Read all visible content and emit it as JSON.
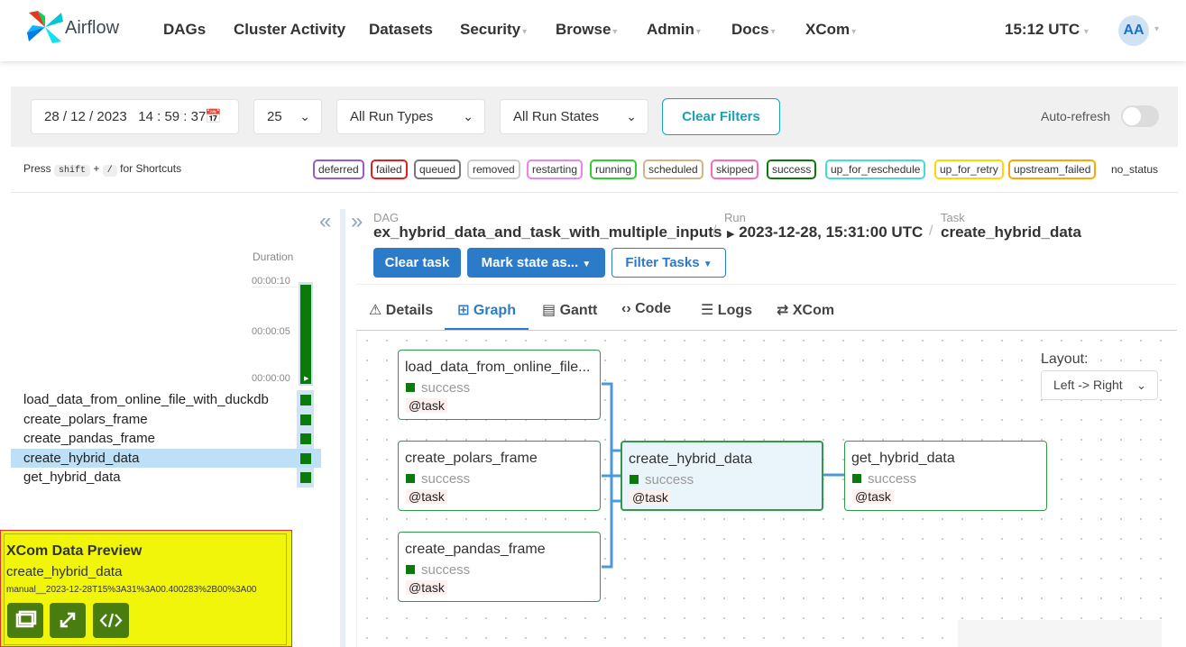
{
  "nav": {
    "brand": "Airflow",
    "items": [
      "DAGs",
      "Cluster Activity",
      "Datasets",
      "Security",
      "Browse",
      "Admin",
      "Docs",
      "XCom"
    ],
    "clock": "15:12 UTC",
    "avatar": "AA"
  },
  "filters": {
    "date": "28 / 12 / 2023",
    "time": "14 : 59 : 37",
    "num_runs": "25",
    "run_types": "All Run Types",
    "run_states": "All Run States",
    "clear_label": "Clear Filters",
    "auto_refresh_label": "Auto-refresh"
  },
  "shortcuts": {
    "press": "Press",
    "key1": "shift",
    "plus": "+",
    "key2": "/",
    "suffix": "for Shortcuts"
  },
  "legend": [
    {
      "label": "deferred",
      "color": "#9b59d0"
    },
    {
      "label": "failed",
      "color": "#e02020"
    },
    {
      "label": "queued",
      "color": "#777777"
    },
    {
      "label": "removed",
      "color": "#cccccc"
    },
    {
      "label": "restarting",
      "color": "#ee82ee"
    },
    {
      "label": "running",
      "color": "#32cd32"
    },
    {
      "label": "scheduled",
      "color": "#d2b48c"
    },
    {
      "label": "skipped",
      "color": "#ff69b4"
    },
    {
      "label": "success",
      "color": "#0a7a0a"
    },
    {
      "label": "up_for_reschedule",
      "color": "#40e0d0"
    },
    {
      "label": "up_for_retry",
      "color": "#ffd700"
    },
    {
      "label": "upstream_failed",
      "color": "#ffa500"
    },
    {
      "label": "no_status",
      "color": "#ffffff"
    }
  ],
  "grid": {
    "duration_label": "Duration",
    "ticks": [
      "00:00:10",
      "00:00:05",
      "00:00:00"
    ],
    "tasks": [
      "load_data_from_online_file_with_duckdb",
      "create_polars_frame",
      "create_pandas_frame",
      "create_hybrid_data",
      "get_hybrid_data"
    ],
    "selected_task": "create_hybrid_data"
  },
  "xcom_preview": {
    "title": "XCom Data Preview",
    "task": "create_hybrid_data",
    "run_id": "manual__2023-12-28T15%3A31%3A00.400283%2B00%3A00",
    "buttons": [
      "window-icon",
      "expand-icon",
      "code-icon"
    ]
  },
  "breadcrumb": {
    "dag_label": "DAG",
    "dag": "ex_hybrid_data_and_task_with_multiple_inputs",
    "run_label": "Run",
    "run": "2023-12-28, 15:31:00 UTC",
    "task_label": "Task",
    "task": "create_hybrid_data"
  },
  "actions": {
    "clear_task": "Clear task",
    "mark_state": "Mark state as...",
    "filter_tasks": "Filter Tasks"
  },
  "tabs": [
    {
      "label": "Details",
      "icon": "warning-icon"
    },
    {
      "label": "Graph",
      "icon": "graph-icon"
    },
    {
      "label": "Gantt",
      "icon": "gantt-icon"
    },
    {
      "label": "Code",
      "icon": "code-icon"
    },
    {
      "label": "Logs",
      "icon": "list-icon"
    },
    {
      "label": "XCom",
      "icon": "arrows-icon"
    }
  ],
  "active_tab": "Graph",
  "graph": {
    "layout_label": "Layout:",
    "layout_value": "Left -> Right",
    "nodes": [
      {
        "name": "load_data_from_online_file...",
        "state": "success",
        "tag": "@task"
      },
      {
        "name": "create_polars_frame",
        "state": "success",
        "tag": "@task"
      },
      {
        "name": "create_pandas_frame",
        "state": "success",
        "tag": "@task"
      },
      {
        "name": "create_hybrid_data",
        "state": "success",
        "tag": "@task"
      },
      {
        "name": "get_hybrid_data",
        "state": "success",
        "tag": "@task"
      }
    ]
  },
  "colors": {
    "primary": "#2c7bc9",
    "success": "#0a7a0a",
    "teal": "#17a2b8",
    "xcom_bg": "#f0f50a"
  }
}
